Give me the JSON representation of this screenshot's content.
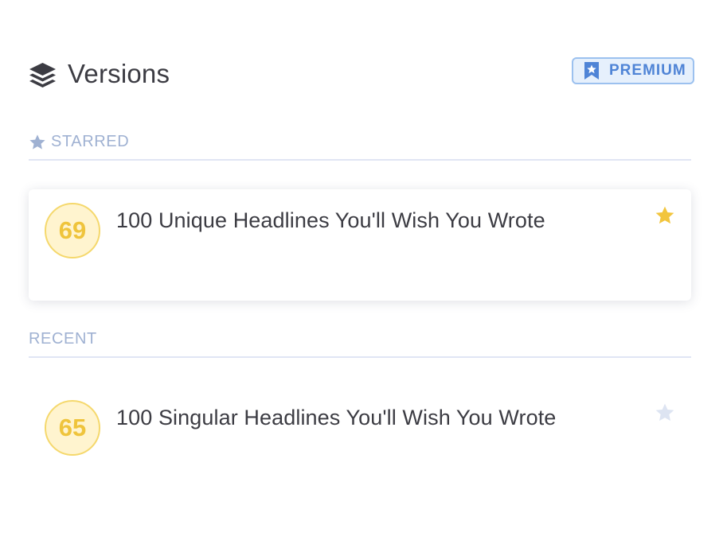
{
  "header": {
    "title": "Versions",
    "icon": "layers-icon",
    "premium_badge": {
      "label": "PREMIUM",
      "icon": "bookmark-star-icon",
      "color": "#4f84d6",
      "background": "#e6f0fc"
    }
  },
  "sections": {
    "starred": {
      "label": "STARRED",
      "icon": "star-icon"
    },
    "recent": {
      "label": "RECENT"
    }
  },
  "versions": {
    "starred": [
      {
        "score": "69",
        "headline": "100 Unique Headlines You'll Wish You Wrote",
        "starred": true
      }
    ],
    "recent": [
      {
        "score": "65",
        "headline": "100 Singular Headlines You'll Wish You Wrote",
        "starred": false
      }
    ]
  },
  "colors": {
    "score_text": "#efc43c",
    "score_background": "#fff4cf",
    "star_active": "#f2c53d",
    "star_inactive": "#dde4f2",
    "section_label": "#9fb1d2"
  }
}
